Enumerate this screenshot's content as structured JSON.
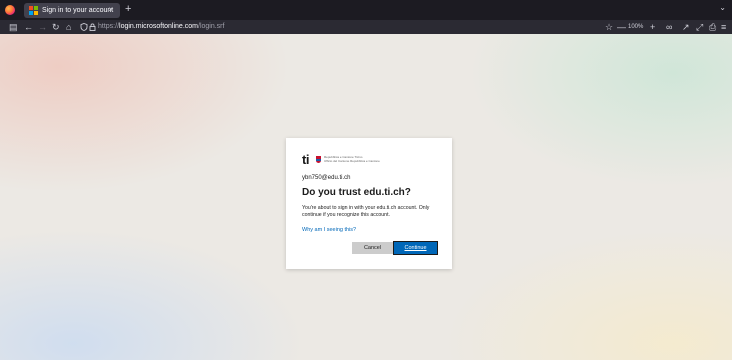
{
  "browser": {
    "tab": {
      "title": "Sign in to your account",
      "close": "×"
    },
    "new_tab": "+",
    "tab_list": "⌄",
    "nav": {
      "back": "←",
      "forward": "→",
      "reload": "↻",
      "home": "⌂",
      "sidebar": "▤"
    },
    "url": {
      "scheme": "https://",
      "host": "login.microsoftonline.com",
      "path": "/login.srf"
    },
    "zoom_minus": "—",
    "zoom": "100%",
    "zoom_plus": "+",
    "toolbar": {
      "bookmark": "☆",
      "extensions": "∞",
      "pin": "↗",
      "expand": "⤢",
      "downloads": "⎙",
      "menu": "≡"
    }
  },
  "dialog": {
    "logo_text": "ti",
    "org_line1": "Repubblica e Cantone Ticino",
    "org_line2": "Ufficio del Cantone Repubblica e Cantone",
    "email": "ybn750@edu.ti.ch",
    "heading": "Do you trust edu.ti.ch?",
    "description": "You're about to sign in with your edu.ti.ch account. Only continue if you recognize this account.",
    "why_link": "Why am I seeing this?",
    "cancel_label": "Cancel",
    "continue_label": "Continue"
  },
  "colors": {
    "accent": "#0067b8",
    "cancel_bg": "#cccccc",
    "chrome_dark": "#1c1b22",
    "navbar": "#2b2a33"
  }
}
